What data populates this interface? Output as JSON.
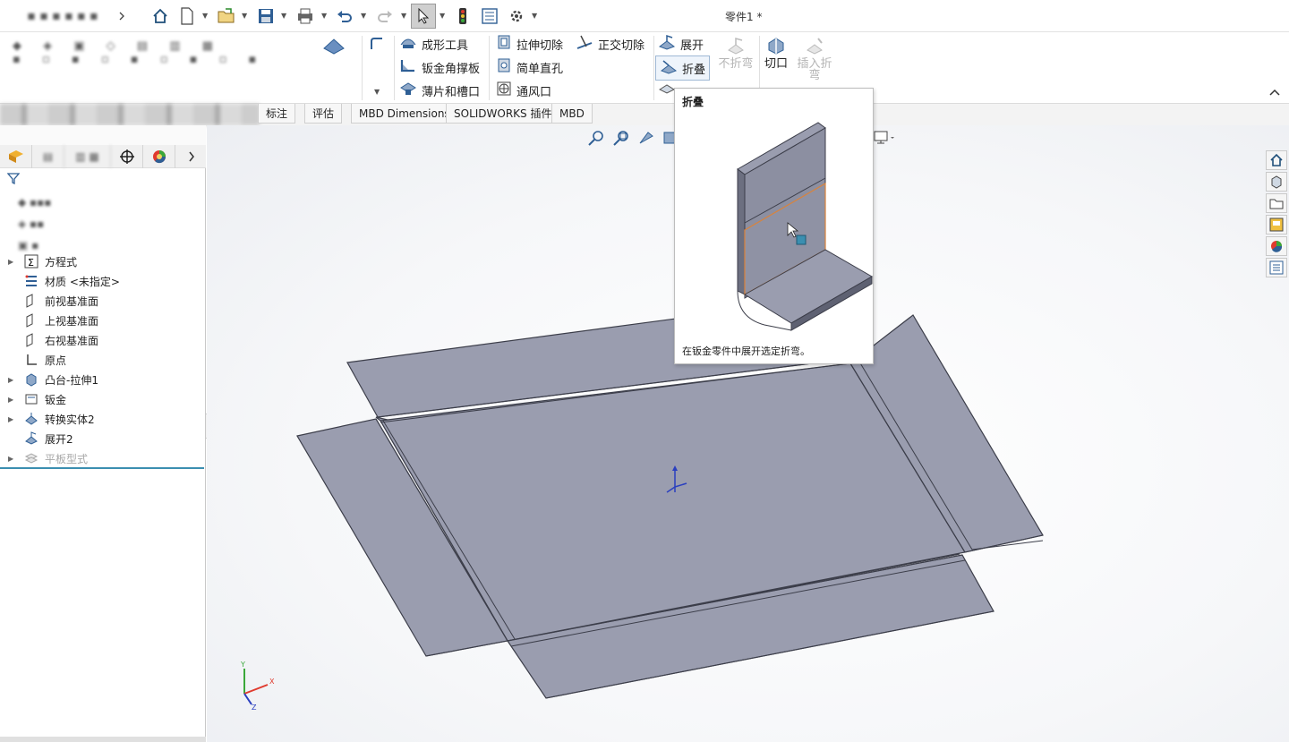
{
  "document_title": "零件1 *",
  "ribbon": {
    "col1": [
      "成形工具",
      "钣金角撑板",
      "薄片和槽口"
    ],
    "col2": [
      "拉伸切除",
      "简单直孔",
      "通风口"
    ],
    "col3_top": "正交切除",
    "col4": [
      "展开",
      "折叠"
    ],
    "no_bend": "不折弯",
    "cut": "切口",
    "insert_bend": "插入折弯"
  },
  "tabs": [
    "标注",
    "评估",
    "MBD Dimensions",
    "SOLIDWORKS 插件",
    "MBD"
  ],
  "tree": [
    {
      "label": "方程式",
      "icon": "equation-icon",
      "expand": true
    },
    {
      "label": "材质 <未指定>",
      "icon": "material-icon",
      "expand": false
    },
    {
      "label": "前视基准面",
      "icon": "plane-icon",
      "expand": false
    },
    {
      "label": "上视基准面",
      "icon": "plane-icon",
      "expand": false
    },
    {
      "label": "右视基准面",
      "icon": "plane-icon",
      "expand": false
    },
    {
      "label": "原点",
      "icon": "origin-icon",
      "expand": false
    },
    {
      "label": "凸台-拉伸1",
      "icon": "extrude-icon",
      "expand": true
    },
    {
      "label": "钣金",
      "icon": "sheetmetal-icon",
      "expand": true
    },
    {
      "label": "转换实体2",
      "icon": "convert-icon",
      "expand": true
    },
    {
      "label": "展开2",
      "icon": "unfold-icon",
      "expand": false
    },
    {
      "label": "平板型式",
      "icon": "flat-pattern-icon",
      "expand": true,
      "dimmed": true
    }
  ],
  "tooltip": {
    "title": "折叠",
    "description": "在钣金零件中展开选定折弯。"
  },
  "triad": {
    "x": "X",
    "y": "Y",
    "z": "Z"
  },
  "colors": {
    "sheet_face": "#9a9daf",
    "sheet_edge": "#3c3e4a",
    "accent": "#3b8fb0",
    "highlight_edge": "#d9833c"
  }
}
